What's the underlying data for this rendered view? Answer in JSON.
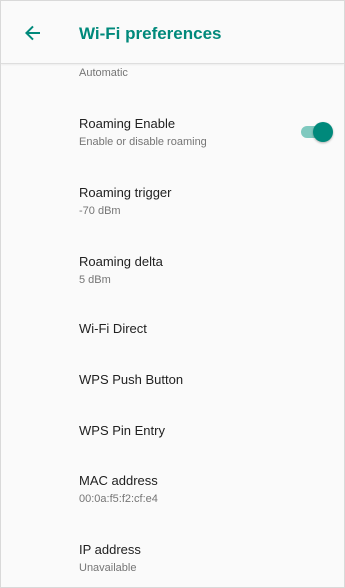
{
  "app_bar": {
    "title": "Wi-Fi preferences",
    "back_icon": "arrow-back-icon"
  },
  "colors": {
    "accent": "#00897b",
    "toggle_track": "#7fc9bf",
    "title_text": "#212121",
    "summary_text": "#757575"
  },
  "cut_off_item": {
    "summary": "Automatic"
  },
  "preferences": [
    {
      "title": "Roaming Enable",
      "summary": "Enable or disable roaming",
      "toggle": true,
      "toggle_on": true
    },
    {
      "title": "Roaming trigger",
      "summary": "-70 dBm"
    },
    {
      "title": "Roaming delta",
      "summary": "5 dBm"
    },
    {
      "title": "Wi-Fi Direct"
    },
    {
      "title": "WPS Push Button"
    },
    {
      "title": "WPS Pin Entry"
    },
    {
      "title": "MAC address",
      "summary": "00:0a:f5:f2:cf:e4"
    },
    {
      "title": "IP address",
      "summary": "Unavailable"
    }
  ]
}
